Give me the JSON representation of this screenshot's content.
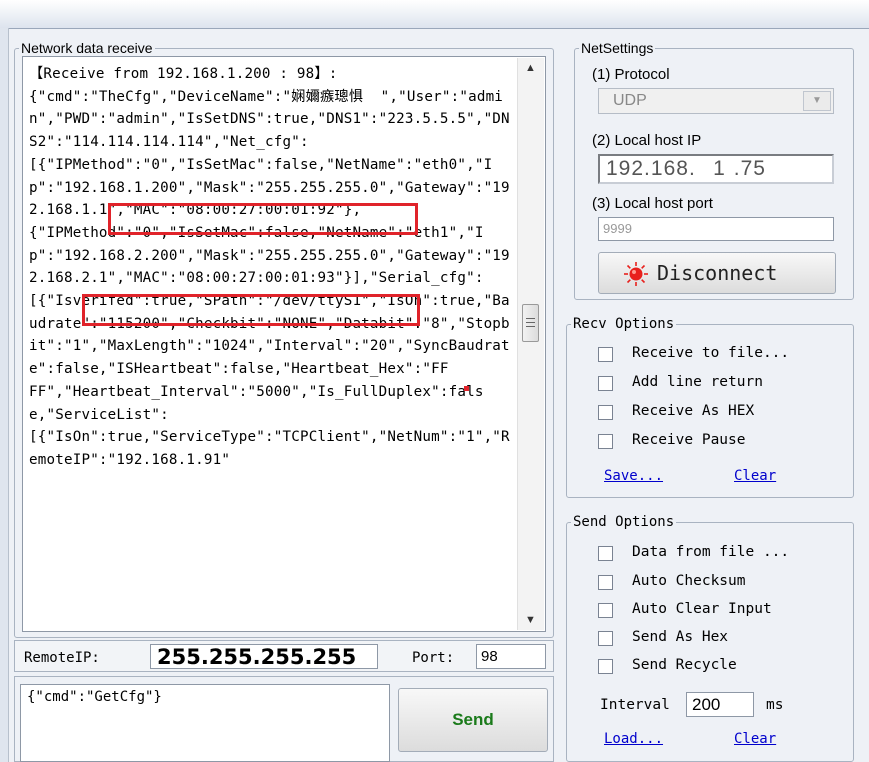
{
  "receive": {
    "legend": "Network data receive",
    "text": "【Receive from 192.168.1.200 : 98】:\n{\"cmd\":\"TheCfg\",\"DeviceName\":\"娴嬭瘯璁惧  \",\"User\":\"admin\",\"PWD\":\"admin\",\"IsSetDNS\":true,\"DNS1\":\"223.5.5.5\",\"DNS2\":\"114.114.114.114\",\"Net_cfg\":\n[{\"IPMethod\":\"0\",\"IsSetMac\":false,\"NetName\":\"eth0\",\"Ip\":\"192.168.1.200\",\"Mask\":\"255.255.255.0\",\"Gateway\":\"192.168.1.1\",\"MAC\":\"08:00:27:00:01:92\"},\n{\"IPMethod\":\"0\",\"IsSetMac\":false,\"NetName\":\"eth1\",\"Ip\":\"192.168.2.200\",\"Mask\":\"255.255.255.0\",\"Gateway\":\"192.168.2.1\",\"MAC\":\"08:00:27:00:01:93\"}],\"Serial_cfg\":\n[{\"Isverifed\":true,\"SPath\":\"/dev/ttyS1\",\"IsOn\":true,\"Baudrate\":\"115200\",\"Checkbit\":\"NONE\",\"Databit\":\"8\",\"Stopbit\":\"1\",\"MaxLength\":\"1024\",\"Interval\":\"20\",\"SyncBaudrate\":false,\"ISHeartbeat\":false,\"Heartbeat_Hex\":\"FF\nFF\",\"Heartbeat_Interval\":\"5000\",\"Is_FullDuplex\":false,\"ServiceList\":\n[{\"IsOn\":true,\"ServiceType\":\"TCPClient\",\"NetNum\":\"1\",\"RemoteIP\":\"192.168.1.91\""
  },
  "remote": {
    "ip_label": "RemoteIP:",
    "ip_value": "255.255.255.255",
    "port_label": "Port:",
    "port_value": "98"
  },
  "send": {
    "input_value": "{\"cmd\":\"GetCfg\"}",
    "button_label": "Send"
  },
  "net_settings": {
    "legend": "NetSettings",
    "protocol_label": "(1) Protocol",
    "protocol_value": "UDP",
    "host_ip_label": "(2) Local host IP",
    "ip_octets": [
      "192",
      "168",
      "1",
      "75"
    ],
    "host_port_label": "(3) Local host port",
    "host_port_value": "9999",
    "connect_button": "Disconnect"
  },
  "recv_options": {
    "legend": "Recv Options",
    "items": [
      "Receive to file...",
      "Add line return",
      "Receive As HEX",
      "Receive Pause"
    ],
    "save_link": "Save...",
    "clear_link": "Clear"
  },
  "send_options": {
    "legend": "Send Options",
    "items": [
      "Data from file ...",
      "Auto Checksum",
      "Auto Clear Input",
      "Send As Hex",
      "Send Recycle"
    ],
    "interval_label": "Interval",
    "interval_value": "200",
    "interval_unit": "ms",
    "load_link": "Load...",
    "clear_link": "Clear"
  },
  "colors": {
    "highlight_box": "#e0232a",
    "link": "#0000cc",
    "send_label": "#1a7a1a",
    "disconnect_indicator": "#e8201c"
  }
}
